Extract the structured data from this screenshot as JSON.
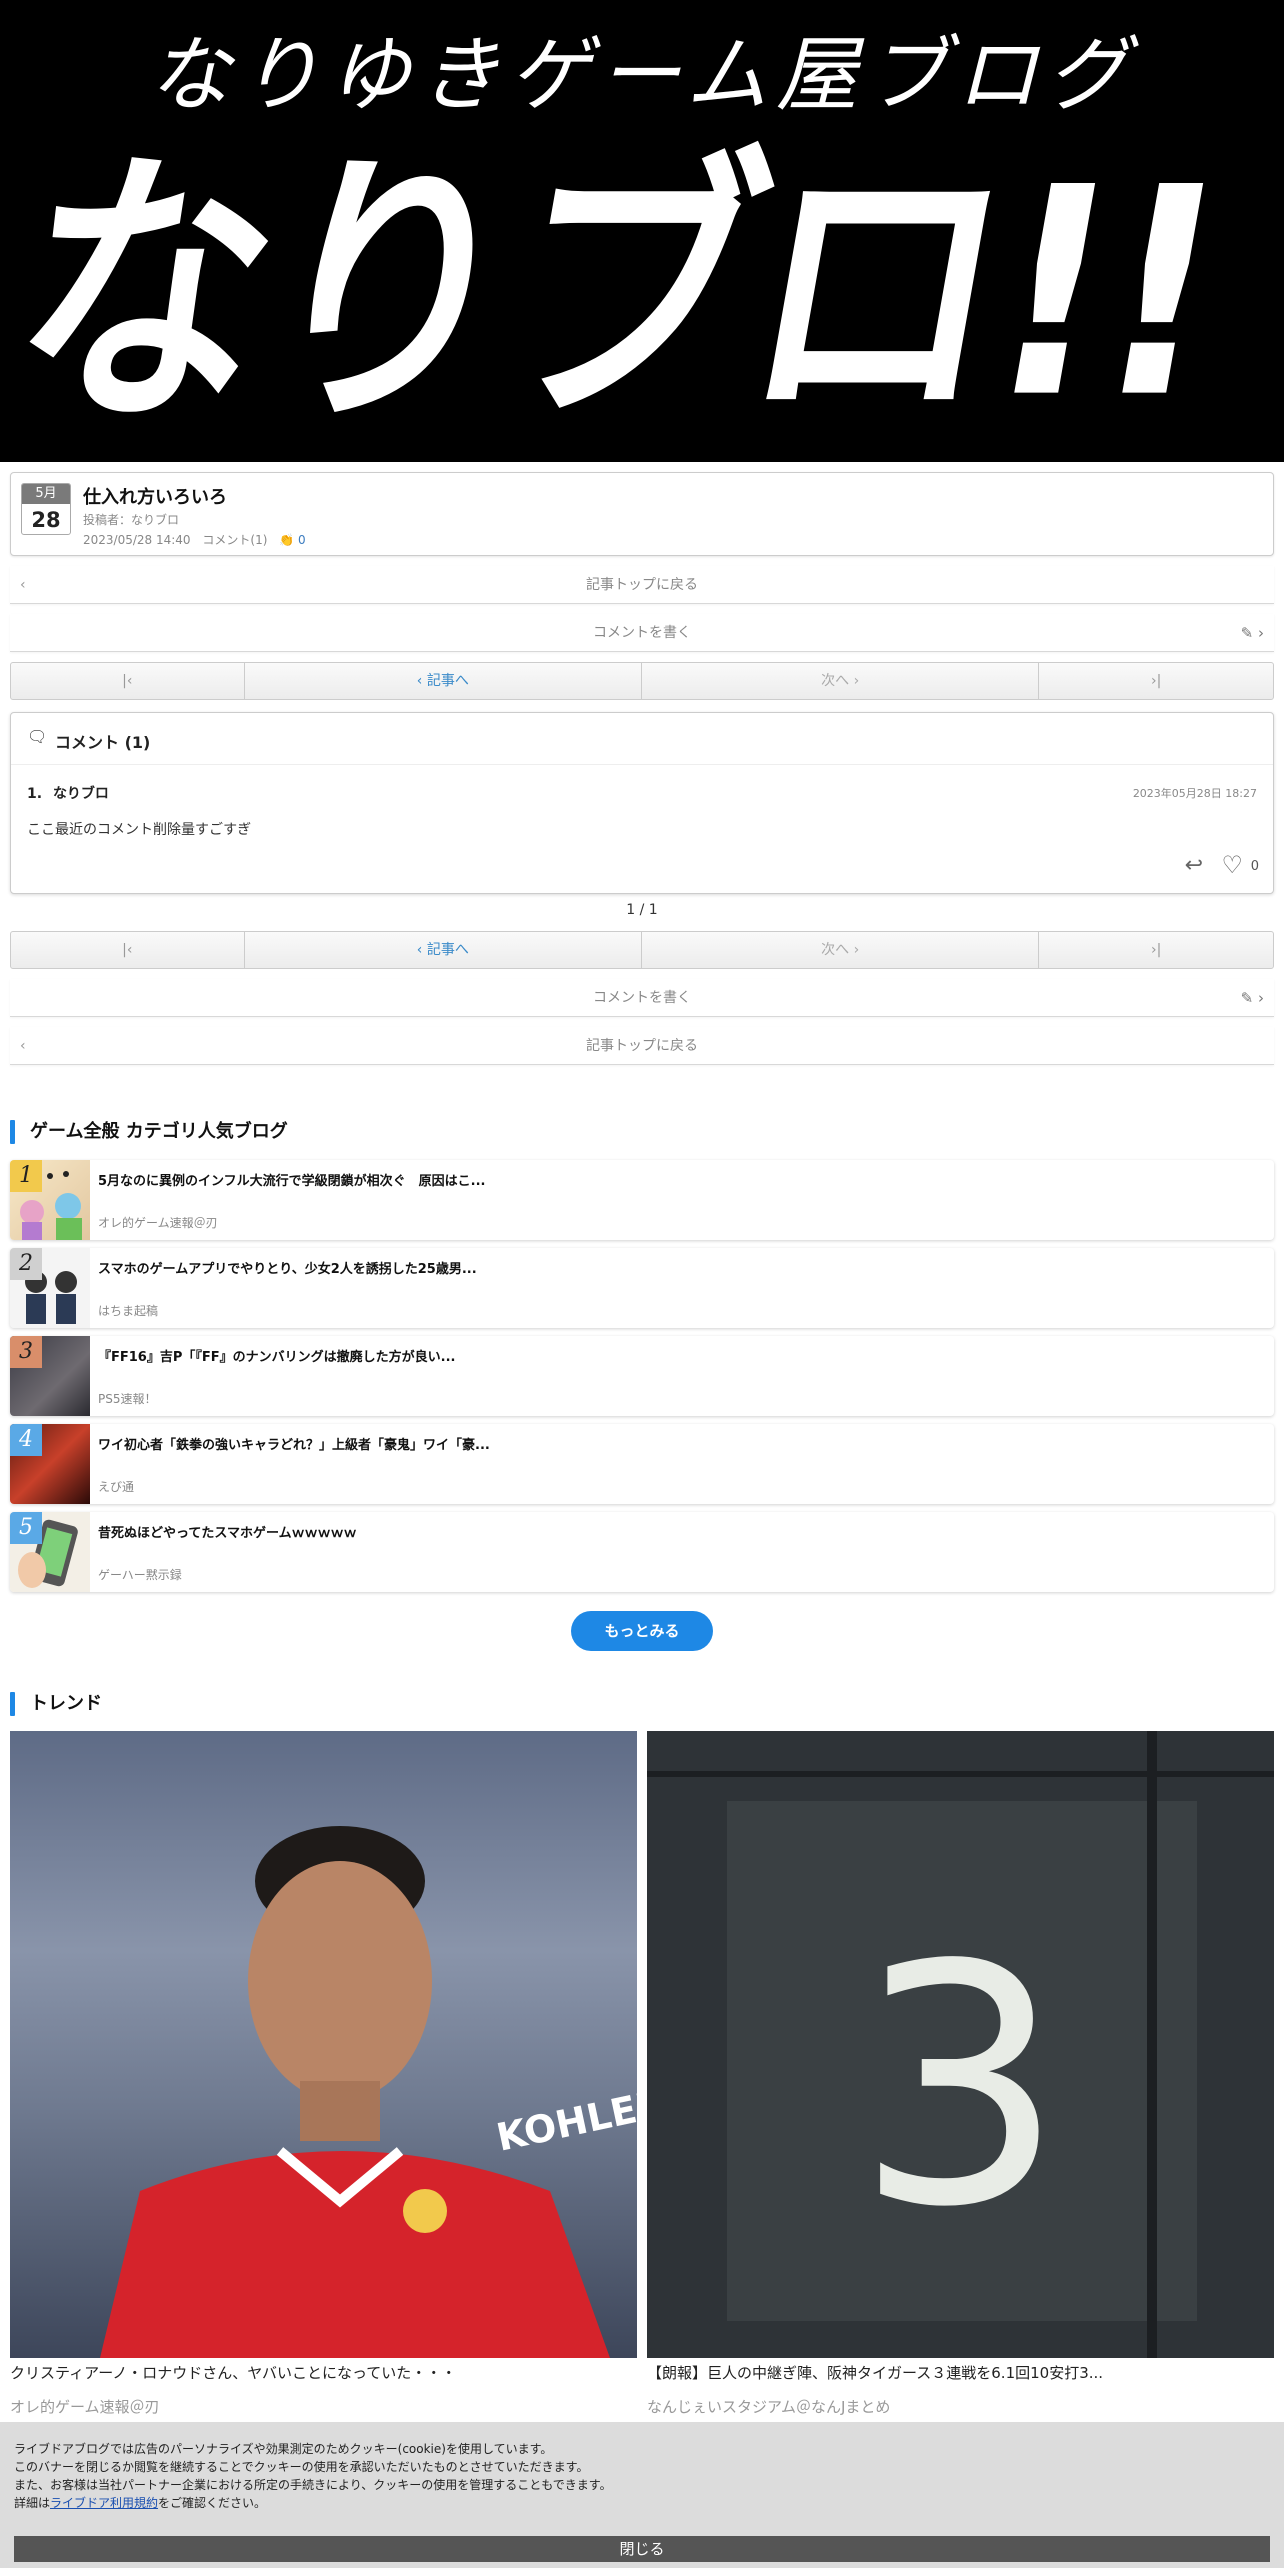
{
  "banner": {
    "subtitle": "なりゆきゲーム屋ブログ",
    "logo": "なりブロ!!"
  },
  "article": {
    "month": "5月",
    "day": "28",
    "title": "仕入れ方いろいろ",
    "author": "投稿者：なりブロ",
    "datetime": "2023/05/28 14:40",
    "comments": "コメント(1)",
    "clap_count": "0"
  },
  "nav": {
    "back_to_top": "記事トップに戻る",
    "write_comment": "コメントを書く",
    "prev": "記事へ",
    "next": "次へ"
  },
  "comment_section": {
    "title": "コメント (1)",
    "items": [
      {
        "number": "1.",
        "author": "なりブロ",
        "date": "2023年05月28日 18:27",
        "body": "ここ最近のコメント削除量すごすぎ",
        "likes": "0"
      }
    ],
    "page_indicator": "1 / 1"
  },
  "ranking": {
    "title": "ゲーム全般 カテゴリ人気ブログ",
    "items": [
      {
        "rank": "1",
        "title": "5月なのに異例のインフル大流行で学級閉鎖が相次ぐ　原因はこ...",
        "source": "オレ的ゲーム速報＠刃",
        "badge_color": "#f2c94c"
      },
      {
        "rank": "2",
        "title": "スマホのゲームアプリでやりとり、少女2人を誘拐した25歳男...",
        "source": "はちま起稿",
        "badge_color": "#d0d0d0"
      },
      {
        "rank": "3",
        "title": "『FF16』吉P「『FF』のナンバリングは撤廃した方が良い...",
        "source": "PS5速報！",
        "badge_color": "#d98e6a"
      },
      {
        "rank": "4",
        "title": "ワイ初心者「鉄拳の強いキャラどれ？」上級者「豪鬼」ワイ「豪...",
        "source": "えび通",
        "badge_color": "#5aa9e6"
      },
      {
        "rank": "5",
        "title": "昔死ぬほどやってたスマホゲームｗｗｗｗｗ",
        "source": "ゲーハー黙示録",
        "badge_color": "#5aa9e6"
      }
    ],
    "more": "もっとみる"
  },
  "trend": {
    "title": "トレンド",
    "items": [
      {
        "caption": "クリスティアーノ・ロナウドさん、ヤバいことになっていた・・・",
        "source": "オレ的ゲーム速報＠刃",
        "image_text": "KOHLER"
      },
      {
        "caption": "【朗報】巨人の中継ぎ陣、阪神タイガース３連戦を6.1回10安打3...",
        "source": "なんじぇいスタジアム＠なんJまとめ",
        "image_text": "3"
      }
    ]
  },
  "cookie": {
    "line1": "ライブドアブログでは広告のパーソナライズや効果測定のためクッキー(cookie)を使用しています。",
    "line2": "このバナーを閉じるか閲覧を継続することでクッキーの使用を承認いただいたものとさせていただきます。",
    "line3": "また、お客様は当社パートナー企業における所定の手続きにより、クッキーの使用を管理することもできます。",
    "line4_pre": "詳細は",
    "line4_link": "ライブドア利用規約",
    "line4_post": "をご確認ください。",
    "close": "閉じる"
  }
}
